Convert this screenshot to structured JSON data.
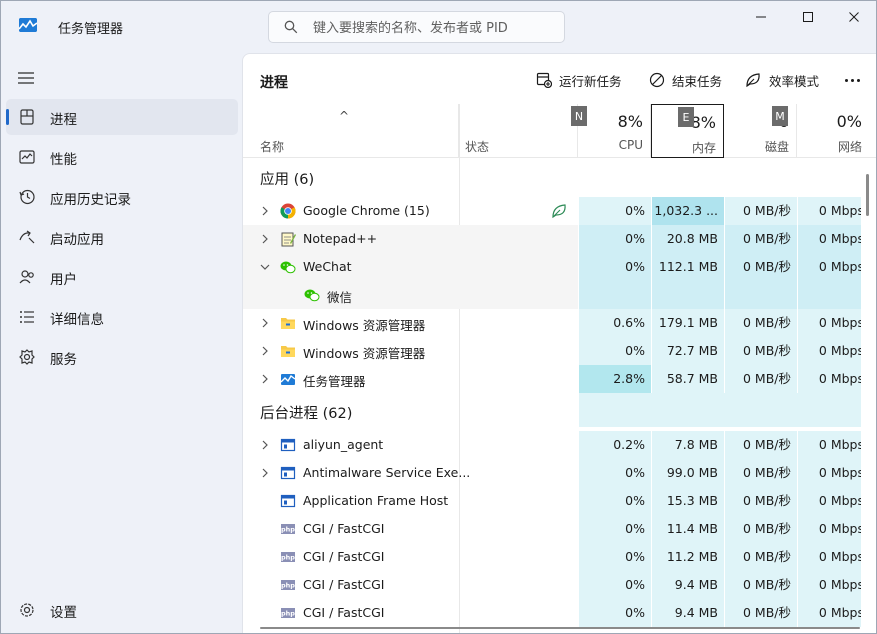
{
  "app": {
    "title": "任务管理器"
  },
  "search": {
    "placeholder": "键入要搜索的名称、发布者或 PID"
  },
  "sidebar": {
    "items": [
      {
        "label": "进程",
        "icon": "processes-icon",
        "active": true
      },
      {
        "label": "性能",
        "icon": "performance-icon",
        "active": false
      },
      {
        "label": "应用历史记录",
        "icon": "app-history-icon",
        "active": false
      },
      {
        "label": "启动应用",
        "icon": "startup-apps-icon",
        "active": false
      },
      {
        "label": "用户",
        "icon": "users-icon",
        "active": false
      },
      {
        "label": "详细信息",
        "icon": "details-icon",
        "active": false
      },
      {
        "label": "服务",
        "icon": "services-icon",
        "active": false
      }
    ],
    "settings": "设置"
  },
  "main": {
    "title": "进程",
    "toolbar": {
      "run_new_task": "运行新任务",
      "end_task": "结束任务",
      "efficiency_mode": "效率模式"
    }
  },
  "header": {
    "name": "名称",
    "status": "状态",
    "columns": [
      {
        "pct": "8%",
        "label": "CPU",
        "key": "N"
      },
      {
        "pct": "8%",
        "label": "内存",
        "key": "E"
      },
      {
        "pct": "0",
        "label": "磁盘",
        "key": "M"
      },
      {
        "pct": "0%",
        "label": "网络",
        "key": ""
      }
    ]
  },
  "groups": {
    "apps": "应用 (6)",
    "background": "后台进程 (62)"
  },
  "rows": [
    {
      "name": "Google Chrome (15)",
      "icon": "chrome-icon",
      "expand": "collapsed",
      "efficiency": true,
      "cpu": "0%",
      "mem": "1,032.3 ...",
      "disk": "0 MB/秒",
      "net": "0 Mbps"
    },
    {
      "name": "Notepad++",
      "icon": "notepad-plus-plus-icon",
      "expand": "collapsed",
      "cpu": "0%",
      "mem": "20.8 MB",
      "disk": "0 MB/秒",
      "net": "0 Mbps"
    },
    {
      "name": "WeChat",
      "icon": "wechat-icon",
      "expand": "expanded",
      "cpu": "0%",
      "mem": "112.1 MB",
      "disk": "0 MB/秒",
      "net": "0 Mbps"
    },
    {
      "name": "微信",
      "icon": "wechat-icon",
      "child": true
    },
    {
      "name": "Windows 资源管理器",
      "icon": "file-explorer-icon",
      "expand": "collapsed",
      "cpu": "0.6%",
      "mem": "179.1 MB",
      "disk": "0 MB/秒",
      "net": "0 Mbps"
    },
    {
      "name": "Windows 资源管理器",
      "icon": "file-explorer-icon",
      "expand": "collapsed",
      "cpu": "0%",
      "mem": "72.7 MB",
      "disk": "0 MB/秒",
      "net": "0 Mbps"
    },
    {
      "name": "任务管理器",
      "icon": "task-manager-icon",
      "expand": "collapsed",
      "cpu": "2.8%",
      "mem": "58.7 MB",
      "disk": "0 MB/秒",
      "net": "0 Mbps"
    },
    {
      "name": "aliyun_agent",
      "icon": "app-window-icon",
      "expand": "collapsed",
      "cpu": "0.2%",
      "mem": "7.8 MB",
      "disk": "0 MB/秒",
      "net": "0 Mbps"
    },
    {
      "name": "Antimalware Service Exe...",
      "icon": "app-window-icon",
      "expand": "collapsed",
      "cpu": "0%",
      "mem": "99.0 MB",
      "disk": "0 MB/秒",
      "net": "0 Mbps"
    },
    {
      "name": "Application Frame Host",
      "icon": "app-window-icon",
      "expand": "none",
      "cpu": "0%",
      "mem": "15.3 MB",
      "disk": "0 MB/秒",
      "net": "0 Mbps"
    },
    {
      "name": "CGI / FastCGI",
      "icon": "php-icon",
      "expand": "none",
      "cpu": "0%",
      "mem": "11.4 MB",
      "disk": "0 MB/秒",
      "net": "0 Mbps"
    },
    {
      "name": "CGI / FastCGI",
      "icon": "php-icon",
      "expand": "none",
      "cpu": "0%",
      "mem": "11.2 MB",
      "disk": "0 MB/秒",
      "net": "0 Mbps"
    },
    {
      "name": "CGI / FastCGI",
      "icon": "php-icon",
      "expand": "none",
      "cpu": "0%",
      "mem": "9.4 MB",
      "disk": "0 MB/秒",
      "net": "0 Mbps"
    },
    {
      "name": "CGI / FastCGI",
      "icon": "php-icon",
      "expand": "none",
      "cpu": "0%",
      "mem": "9.4 MB",
      "disk": "0 MB/秒",
      "net": "0 Mbps"
    }
  ],
  "colors": {
    "accent": "#1f68c9",
    "heat_low": "#dff4f8",
    "heat_medium": "#cfeef5",
    "heat_high": "#afe3ee",
    "heat_cpu_high": "#b2e7ee",
    "row_selected": "#f5f5f5"
  }
}
